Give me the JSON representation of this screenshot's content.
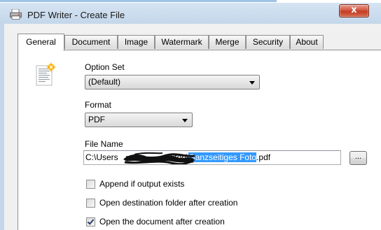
{
  "window": {
    "title": "PDF Writer - Create File",
    "close_glyph": "x"
  },
  "tabs": [
    {
      "label": "General",
      "active": true
    },
    {
      "label": "Document",
      "active": false
    },
    {
      "label": "Image",
      "active": false
    },
    {
      "label": "Watermark",
      "active": false
    },
    {
      "label": "Merge",
      "active": false
    },
    {
      "label": "Security",
      "active": false
    },
    {
      "label": "About",
      "active": false
    }
  ],
  "general": {
    "option_set_label": "Option Set",
    "option_set_value": "(Default)",
    "format_label": "Format",
    "format_value": "PDF",
    "file_name_label": "File Name",
    "file_name": {
      "prefix": "C:\\Users",
      "middle": "esktop\\",
      "selected": "Ganzseitiges Foto",
      "suffix": ".pdf"
    },
    "browse_label": "...",
    "checkboxes": [
      {
        "label": "Append if output exists",
        "checked": false
      },
      {
        "label": "Open destination folder after creation",
        "checked": false
      },
      {
        "label": "Open the document after creation",
        "checked": true
      }
    ]
  },
  "icons": {
    "app": "pdf-writer-app-icon",
    "document": "document-sparkle-icon",
    "redaction": "redaction-scribble"
  },
  "colors": {
    "selection": "#3399ff",
    "close_button": "#c8452b",
    "titlebar": "#c9daed"
  }
}
